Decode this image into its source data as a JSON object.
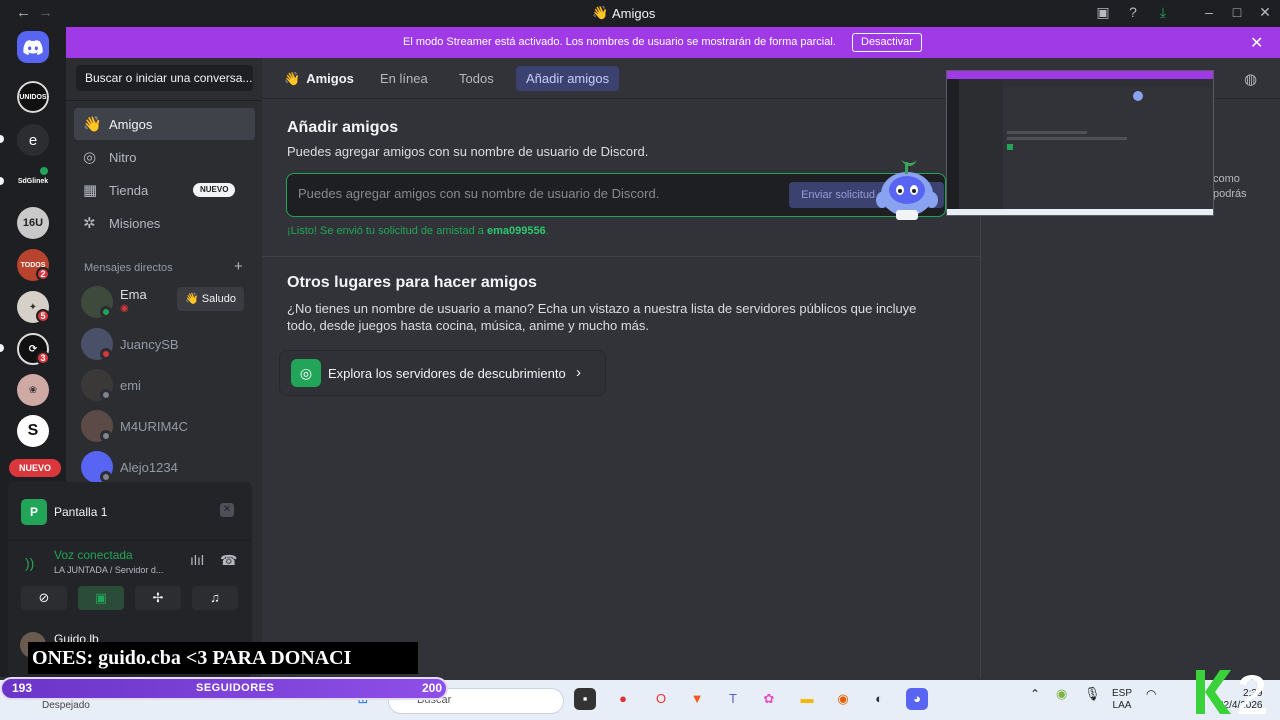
{
  "window": {
    "title": "Amigos"
  },
  "banner": {
    "message": "El modo Streamer está activado. Los nombres de usuario se mostrarán de forma parcial.",
    "button": "Desactivar"
  },
  "rail": {
    "server_initial": "e",
    "server_label": "SdGlinek",
    "badges": [
      "2",
      "5",
      "3"
    ],
    "new_label": "NUEVO"
  },
  "sidebar": {
    "search": "Buscar o iniciar una conversa...",
    "nav": [
      {
        "label": "Amigos"
      },
      {
        "label": "Nitro"
      },
      {
        "label": "Tienda",
        "tag": "NUEVO"
      },
      {
        "label": "Misiones"
      }
    ],
    "dm_header": "Mensajes directos",
    "dms": [
      {
        "name": "Ema",
        "action": "Saludo"
      },
      {
        "name": "JuancySB"
      },
      {
        "name": "emi"
      },
      {
        "name": "M4URIM4C"
      },
      {
        "name": "Alejo1234"
      }
    ]
  },
  "voice": {
    "screen": "Pantalla 1",
    "screen_initial": "P",
    "status": "Voz conectada",
    "channel": "LA JUNTADA / Servidor d...",
    "user": "Guido.lb"
  },
  "topbar": {
    "title": "Amigos",
    "tabs": [
      "En línea",
      "Todos",
      "Añadir amigos"
    ]
  },
  "add_friend": {
    "title": "Añadir amigos",
    "subtitle": "Puedes agregar amigos con su nombre de usuario de Discord.",
    "placeholder": "Puedes agregar amigos con su nombre de usuario de Discord.",
    "send_button": "Enviar solicitud de amistad",
    "success_prefix": "¡Listo! Se envió tu solicitud de amistad a ",
    "success_user": "ema099556",
    "success_suffix": "."
  },
  "other_places": {
    "title": "Otros lugares para hacer amigos",
    "text": "¿No tienes un nombre de usuario a mano? Echa un vistazo a nuestra lista de servidores públicos que incluye todo, desde juegos hasta cocina, música, anime y mucho más.",
    "discover": "Explora los servidores de descubrimiento"
  },
  "right_panel": {
    "line1": "como",
    "line2": "podrás"
  },
  "overlay": {
    "ticker": "ONES: guido.cba  <3     PARA DONACI",
    "followers_left": "193",
    "followers_label": "SEGUIDORES",
    "followers_right": "200"
  },
  "taskbar": {
    "weather": "Despejado",
    "search": "Buscar",
    "lang1": "ESP",
    "lang2": "LAA",
    "time": "2:39",
    "date": "22/4/2026"
  },
  "colors": {
    "banner": "#a03ae6",
    "accent": "#5865f2",
    "green": "#23a559",
    "red": "#da373c"
  }
}
